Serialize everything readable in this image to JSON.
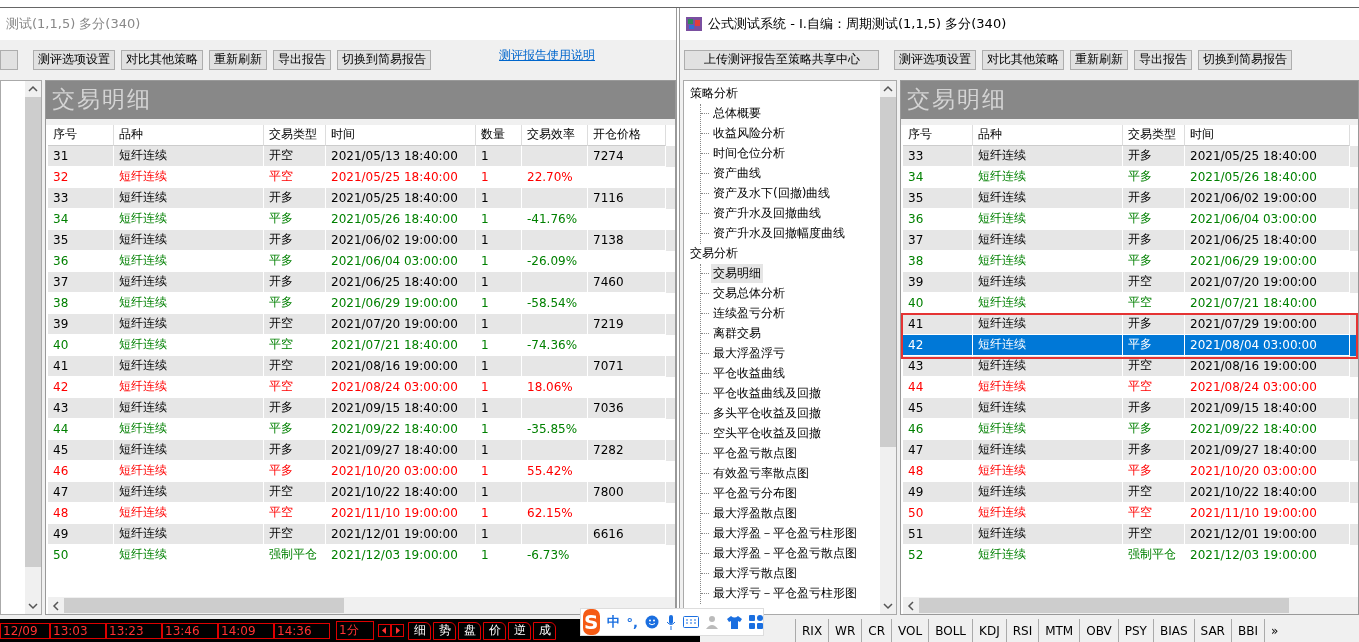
{
  "left_window": {
    "title": "测试(1,1,5) 多分(340)",
    "toolbar": {
      "buttons": [
        "测评选项设置",
        "对比其他策略",
        "重新刷新",
        "导出报告",
        "切换到简易报告"
      ],
      "link": "测评报告使用说明"
    },
    "panel_title": "交易明细",
    "table": {
      "columns": [
        "序号",
        "品种",
        "交易类型",
        "时间",
        "数量",
        "交易效率",
        "开仓价格"
      ],
      "rows": [
        {
          "no": "31",
          "symbol": "短纤连续",
          "type": "开空",
          "time": "2021/05/13 18:40:00",
          "qty": "1",
          "open_price": "7274",
          "color": "#000000"
        },
        {
          "no": "32",
          "symbol": "短纤连续",
          "type": "平空",
          "time": "2021/05/25 18:40:00",
          "qty": "1",
          "efficiency": "22.70%",
          "color": "#ff0000"
        },
        {
          "no": "33",
          "symbol": "短纤连续",
          "type": "开多",
          "time": "2021/05/25 18:40:00",
          "qty": "1",
          "open_price": "7116",
          "color": "#000000"
        },
        {
          "no": "34",
          "symbol": "短纤连续",
          "type": "平多",
          "time": "2021/05/26 18:40:00",
          "qty": "1",
          "efficiency": "-41.76%",
          "color": "#008000"
        },
        {
          "no": "35",
          "symbol": "短纤连续",
          "type": "开多",
          "time": "2021/06/02 19:00:00",
          "qty": "1",
          "open_price": "7138",
          "color": "#000000"
        },
        {
          "no": "36",
          "symbol": "短纤连续",
          "type": "平多",
          "time": "2021/06/04 03:00:00",
          "qty": "1",
          "efficiency": "-26.09%",
          "color": "#008000"
        },
        {
          "no": "37",
          "symbol": "短纤连续",
          "type": "开多",
          "time": "2021/06/25 18:40:00",
          "qty": "1",
          "open_price": "7460",
          "color": "#000000"
        },
        {
          "no": "38",
          "symbol": "短纤连续",
          "type": "平多",
          "time": "2021/06/29 19:00:00",
          "qty": "1",
          "efficiency": "-58.54%",
          "color": "#008000"
        },
        {
          "no": "39",
          "symbol": "短纤连续",
          "type": "开空",
          "time": "2021/07/20 19:00:00",
          "qty": "1",
          "open_price": "7219",
          "color": "#000000"
        },
        {
          "no": "40",
          "symbol": "短纤连续",
          "type": "平空",
          "time": "2021/07/21 18:40:00",
          "qty": "1",
          "efficiency": "-74.36%",
          "color": "#008000"
        },
        {
          "no": "41",
          "symbol": "短纤连续",
          "type": "开空",
          "time": "2021/08/16 19:00:00",
          "qty": "1",
          "open_price": "7071",
          "color": "#000000"
        },
        {
          "no": "42",
          "symbol": "短纤连续",
          "type": "平空",
          "time": "2021/08/24 03:00:00",
          "qty": "1",
          "efficiency": "18.06%",
          "color": "#ff0000"
        },
        {
          "no": "43",
          "symbol": "短纤连续",
          "type": "开多",
          "time": "2021/09/15 18:40:00",
          "qty": "1",
          "open_price": "7036",
          "color": "#000000"
        },
        {
          "no": "44",
          "symbol": "短纤连续",
          "type": "平多",
          "time": "2021/09/22 18:40:00",
          "qty": "1",
          "efficiency": "-35.85%",
          "color": "#008000"
        },
        {
          "no": "45",
          "symbol": "短纤连续",
          "type": "开多",
          "time": "2021/09/27 18:40:00",
          "qty": "1",
          "open_price": "7282",
          "color": "#000000"
        },
        {
          "no": "46",
          "symbol": "短纤连续",
          "type": "平多",
          "time": "2021/10/20 03:00:00",
          "qty": "1",
          "efficiency": "55.42%",
          "color": "#ff0000"
        },
        {
          "no": "47",
          "symbol": "短纤连续",
          "type": "开空",
          "time": "2021/10/22 18:40:00",
          "qty": "1",
          "open_price": "7800",
          "color": "#000000"
        },
        {
          "no": "48",
          "symbol": "短纤连续",
          "type": "平空",
          "time": "2021/11/10 19:00:00",
          "qty": "1",
          "efficiency": "62.15%",
          "color": "#ff0000"
        },
        {
          "no": "49",
          "symbol": "短纤连续",
          "type": "开空",
          "time": "2021/12/01 19:00:00",
          "qty": "1",
          "open_price": "6616",
          "color": "#000000"
        },
        {
          "no": "50",
          "symbol": "短纤连续",
          "type": "强制平仓",
          "time": "2021/12/03 19:00:00",
          "qty": "1",
          "efficiency": "-6.73%",
          "color": "#008000"
        }
      ]
    }
  },
  "right_window": {
    "title": "公式测试系统 - I.自编：周期测试(1,1,5) 多分(340)",
    "upload_button": "上传测评报告至策略共享中心",
    "toolbar": {
      "buttons": [
        "测评选项设置",
        "对比其他策略",
        "重新刷新",
        "导出报告",
        "切换到简易报告"
      ]
    },
    "tree": [
      {
        "label": "策略分析",
        "selected": false,
        "children": [
          {
            "label": "总体概要",
            "selected": false
          },
          {
            "label": "收益风险分析",
            "selected": false
          },
          {
            "label": "时间仓位分析",
            "selected": false
          },
          {
            "label": "资产曲线",
            "selected": false
          },
          {
            "label": "资产及水下(回撤)曲线",
            "selected": false
          },
          {
            "label": "资产升水及回撤曲线",
            "selected": false
          },
          {
            "label": "资产升水及回撤幅度曲线",
            "selected": false
          }
        ]
      },
      {
        "label": "交易分析",
        "selected": false,
        "children": [
          {
            "label": "交易明细",
            "selected": true
          },
          {
            "label": "交易总体分析",
            "selected": false
          },
          {
            "label": "连续盈亏分析",
            "selected": false
          },
          {
            "label": "离群交易",
            "selected": false
          },
          {
            "label": "最大浮盈浮亏",
            "selected": false
          },
          {
            "label": "平仓收益曲线",
            "selected": false
          },
          {
            "label": "平仓收益曲线及回撤",
            "selected": false
          },
          {
            "label": "多头平仓收益及回撤",
            "selected": false
          },
          {
            "label": "空头平仓收益及回撤",
            "selected": false
          },
          {
            "label": "平仓盈亏散点图",
            "selected": false
          },
          {
            "label": "有效盈亏率散点图",
            "selected": false
          },
          {
            "label": "平仓盈亏分布图",
            "selected": false
          },
          {
            "label": "最大浮盈散点图",
            "selected": false
          },
          {
            "label": "最大浮盈－平仓盈亏柱形图",
            "selected": false
          },
          {
            "label": "最大浮盈－平仓盈亏散点图",
            "selected": false
          },
          {
            "label": "最大浮亏散点图",
            "selected": false
          },
          {
            "label": "最大浮亏－平仓盈亏柱形图",
            "selected": false
          }
        ]
      }
    ],
    "panel_title": "交易明细",
    "table": {
      "columns": [
        "序号",
        "品种",
        "交易类型",
        "时间"
      ],
      "rows": [
        {
          "no": "33",
          "symbol": "短纤连续",
          "type": "开多",
          "time": "2021/05/25 18:40:00",
          "color": "#000000",
          "selected": false,
          "marked": false
        },
        {
          "no": "34",
          "symbol": "短纤连续",
          "type": "平多",
          "time": "2021/05/26 18:40:00",
          "color": "#008000",
          "selected": false,
          "marked": false
        },
        {
          "no": "35",
          "symbol": "短纤连续",
          "type": "开多",
          "time": "2021/06/02 19:00:00",
          "color": "#000000",
          "selected": false,
          "marked": false
        },
        {
          "no": "36",
          "symbol": "短纤连续",
          "type": "平多",
          "time": "2021/06/04 03:00:00",
          "color": "#008000",
          "selected": false,
          "marked": false
        },
        {
          "no": "37",
          "symbol": "短纤连续",
          "type": "开多",
          "time": "2021/06/25 18:40:00",
          "color": "#000000",
          "selected": false,
          "marked": false
        },
        {
          "no": "38",
          "symbol": "短纤连续",
          "type": "平多",
          "time": "2021/06/29 19:00:00",
          "color": "#008000",
          "selected": false,
          "marked": false
        },
        {
          "no": "39",
          "symbol": "短纤连续",
          "type": "开空",
          "time": "2021/07/20 19:00:00",
          "color": "#000000",
          "selected": false,
          "marked": false
        },
        {
          "no": "40",
          "symbol": "短纤连续",
          "type": "平空",
          "time": "2021/07/21 18:40:00",
          "color": "#008000",
          "selected": false,
          "marked": false
        },
        {
          "no": "41",
          "symbol": "短纤连续",
          "type": "开多",
          "time": "2021/07/29 19:00:00",
          "color": "#000000",
          "selected": false,
          "marked": true
        },
        {
          "no": "42",
          "symbol": "短纤连续",
          "type": "平多",
          "time": "2021/08/04 03:00:00",
          "selected": true,
          "marked": true
        },
        {
          "no": "43",
          "symbol": "短纤连续",
          "type": "开空",
          "time": "2021/08/16 19:00:00",
          "color": "#000000",
          "selected": false,
          "marked": false
        },
        {
          "no": "44",
          "symbol": "短纤连续",
          "type": "平空",
          "time": "2021/08/24 03:00:00",
          "color": "#ff0000",
          "selected": false,
          "marked": false
        },
        {
          "no": "45",
          "symbol": "短纤连续",
          "type": "开多",
          "time": "2021/09/15 18:40:00",
          "color": "#000000",
          "selected": false,
          "marked": false
        },
        {
          "no": "46",
          "symbol": "短纤连续",
          "type": "平多",
          "time": "2021/09/22 18:40:00",
          "color": "#008000",
          "selected": false,
          "marked": false
        },
        {
          "no": "47",
          "symbol": "短纤连续",
          "type": "开多",
          "time": "2021/09/27 18:40:00",
          "color": "#000000",
          "selected": false,
          "marked": false
        },
        {
          "no": "48",
          "symbol": "短纤连续",
          "type": "平多",
          "time": "2021/10/20 03:00:00",
          "color": "#ff0000",
          "selected": false,
          "marked": false
        },
        {
          "no": "49",
          "symbol": "短纤连续",
          "type": "开空",
          "time": "2021/10/22 18:40:00",
          "color": "#000000",
          "selected": false,
          "marked": false
        },
        {
          "no": "50",
          "symbol": "短纤连续",
          "type": "平空",
          "time": "2021/11/10 19:00:00",
          "color": "#ff0000",
          "selected": false,
          "marked": false
        },
        {
          "no": "51",
          "symbol": "短纤连续",
          "type": "开空",
          "time": "2021/12/01 19:00:00",
          "color": "#000000",
          "selected": false,
          "marked": false
        },
        {
          "no": "52",
          "symbol": "短纤连续",
          "type": "强制平仓",
          "time": "2021/12/03 19:00:00",
          "color": "#008000",
          "selected": false,
          "marked": false
        }
      ]
    }
  },
  "status_bar": {
    "times": [
      "12/09",
      "13:03",
      "13:23",
      "13:46",
      "14:09",
      "14:36"
    ],
    "period": "1分",
    "tabs": [
      "细",
      "势",
      "盘",
      "价",
      "逆",
      "成"
    ],
    "indicators": [
      "RIX",
      "WR",
      "CR",
      "VOL",
      "BOLL",
      "KDJ",
      "RSI",
      "MTM",
      "OBV",
      "PSY",
      "BIAS",
      "SAR",
      "BBI",
      "»"
    ]
  },
  "ime_toolbar": {
    "logo": "S",
    "items": [
      "中",
      "°,"
    ]
  }
}
